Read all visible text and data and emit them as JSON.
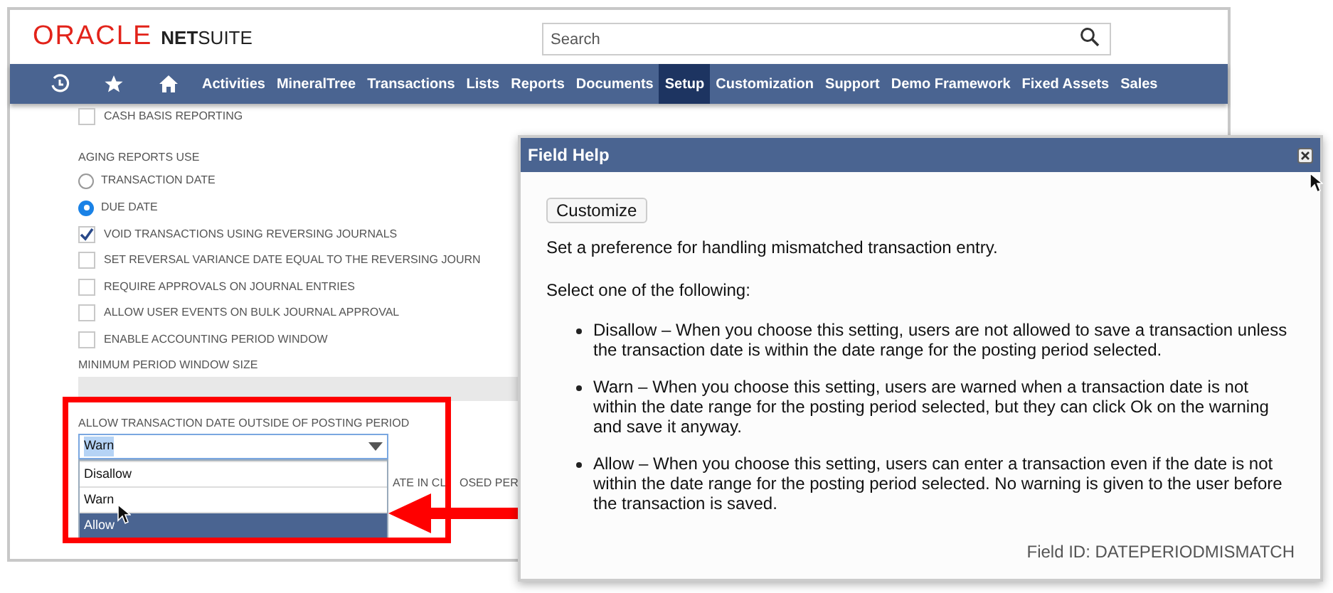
{
  "header": {
    "logo_brand": "ORACLE",
    "logo_product_bold": "NET",
    "logo_product": "SUITE",
    "search": {
      "placeholder": "Search"
    }
  },
  "nav": [
    {
      "label": "Activities",
      "selected": false
    },
    {
      "label": "MineralTree",
      "selected": false
    },
    {
      "label": "Transactions",
      "selected": false
    },
    {
      "label": "Lists",
      "selected": false
    },
    {
      "label": "Reports",
      "selected": false
    },
    {
      "label": "Documents",
      "selected": false
    },
    {
      "label": "Setup",
      "selected": true
    },
    {
      "label": "Customization",
      "selected": false
    },
    {
      "label": "Support",
      "selected": false
    },
    {
      "label": "Demo Framework",
      "selected": false
    },
    {
      "label": "Fixed Assets",
      "selected": false
    },
    {
      "label": "Sales",
      "selected": false
    }
  ],
  "settings": [
    {
      "kind": "checkbox",
      "label": "CASH BASIS REPORTING",
      "checked": false
    },
    {
      "kind": "heading",
      "label": "AGING REPORTS USE"
    },
    {
      "kind": "radio",
      "label": "TRANSACTION DATE",
      "selected": false
    },
    {
      "kind": "radio",
      "label": "DUE DATE",
      "selected": true
    },
    {
      "kind": "checkbox",
      "label": "VOID TRANSACTIONS USING REVERSING JOURNALS",
      "checked": true
    },
    {
      "kind": "checkbox",
      "label": "SET REVERSAL VARIANCE DATE EQUAL TO THE REVERSING JOURN",
      "checked": false
    },
    {
      "kind": "checkbox",
      "label": "REQUIRE APPROVALS ON JOURNAL ENTRIES",
      "checked": false
    },
    {
      "kind": "checkbox",
      "label": "ALLOW USER EVENTS ON BULK JOURNAL APPROVAL",
      "checked": false
    },
    {
      "kind": "checkbox",
      "label": "ENABLE ACCOUNTING PERIOD WINDOW",
      "checked": false
    },
    {
      "kind": "field",
      "label": "MINIMUM PERIOD WINDOW SIZE"
    }
  ],
  "posting_period": {
    "label": "ALLOW TRANSACTION DATE OUTSIDE OF POSTING PERIOD",
    "value": "Warn",
    "expanded": true,
    "options": [
      {
        "label": "Disallow",
        "highlighted": false
      },
      {
        "label": "Warn",
        "highlighted": false
      },
      {
        "label": "Allow",
        "highlighted": true
      }
    ],
    "partly_hidden_labels": [
      "ATE IN CL",
      "OSED PER"
    ]
  },
  "field_help": {
    "title": "Field Help",
    "button": "Customize",
    "intro": "Set a preference for handling mismatched transaction entry.",
    "prompt": "Select one of the following:",
    "options": [
      "Disallow – When you choose this setting, users are not allowed to save a transaction unless the transaction date is within the date range for the posting period selected.",
      "Warn – When you choose this setting, users are warned when a transaction date is not within the date range for the posting period selected, but they can click Ok on the warning and save it anyway.",
      "Allow – When you choose this setting, users can enter a transaction even if the date is not within the date range for the posting period selected. No warning is given to the user before the transaction is saved."
    ],
    "field_id": "Field ID: DATEPERIODMISMATCH"
  }
}
